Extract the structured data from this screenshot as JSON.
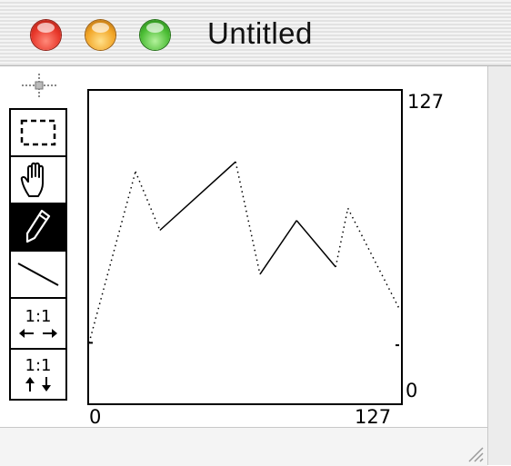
{
  "window": {
    "title": "Untitled"
  },
  "toolbar": {
    "tools": [
      {
        "name": "marquee-select",
        "icon": "dashed-rectangle-icon"
      },
      {
        "name": "hand-pan",
        "icon": "hand-icon"
      },
      {
        "name": "pencil",
        "icon": "pencil-icon",
        "active": true
      },
      {
        "name": "line",
        "icon": "line-icon"
      },
      {
        "name": "horizontal-1-to-1",
        "label": "1:1",
        "icon": "horizontal-arrows-icon"
      },
      {
        "name": "vertical-1-to-1",
        "label": "1:1",
        "icon": "vertical-arrows-icon"
      }
    ],
    "move_icon": "move-crosshair-icon"
  },
  "graph": {
    "x_min_label": "0",
    "x_max_label": "127",
    "y_min_label": "0",
    "y_max_label": "127"
  },
  "chart_data": {
    "type": "line",
    "xlim": [
      0,
      127
    ],
    "ylim": [
      0,
      127
    ],
    "series": [
      {
        "style": "dotted",
        "x": [
          0,
          19
        ],
        "y": [
          24,
          94
        ]
      },
      {
        "style": "dotted",
        "x": [
          19,
          29
        ],
        "y": [
          94,
          70
        ]
      },
      {
        "style": "solid",
        "x": [
          29,
          60
        ],
        "y": [
          70,
          98
        ]
      },
      {
        "style": "dotted",
        "x": [
          60,
          70
        ],
        "y": [
          98,
          52
        ]
      },
      {
        "style": "solid",
        "x": [
          70,
          85
        ],
        "y": [
          52,
          74
        ]
      },
      {
        "style": "solid",
        "x": [
          85,
          101
        ],
        "y": [
          74,
          55
        ]
      },
      {
        "style": "dotted",
        "x": [
          101,
          106
        ],
        "y": [
          55,
          79
        ]
      },
      {
        "style": "dotted",
        "x": [
          106,
          127
        ],
        "y": [
          79,
          38
        ]
      }
    ],
    "end_ticks": [
      24,
      23
    ]
  }
}
